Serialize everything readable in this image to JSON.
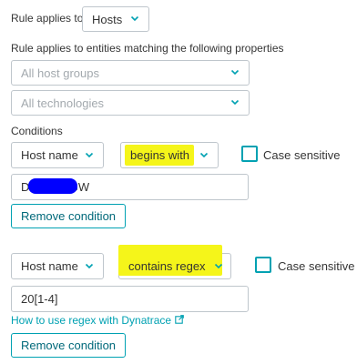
{
  "header": {
    "rule_applies_to_label": "Rule applies to",
    "scope_select_value": "Hosts",
    "entities_label": "Rule applies to entities matching the following properties",
    "host_groups_placeholder": "All host groups",
    "technologies_placeholder": "All technologies",
    "conditions_label": "Conditions"
  },
  "conditions": [
    {
      "property": "Host name",
      "operator": "begins with",
      "case_sensitive_label": "Case sensitive",
      "value": "D            GW",
      "remove_label": "Remove condition"
    },
    {
      "property": "Host name",
      "operator": "contains regex",
      "case_sensitive_label": "Case sensitive",
      "value": "20[1-4]",
      "regex_help_link": "How to use regex with Dynatrace",
      "remove_label": "Remove condition"
    }
  ],
  "colors": {
    "accent": "#00a1b2",
    "highlight": "#f2f21f",
    "redaction": "#0000ff"
  },
  "icons": [
    "chevron-down-icon",
    "external-link-icon"
  ]
}
